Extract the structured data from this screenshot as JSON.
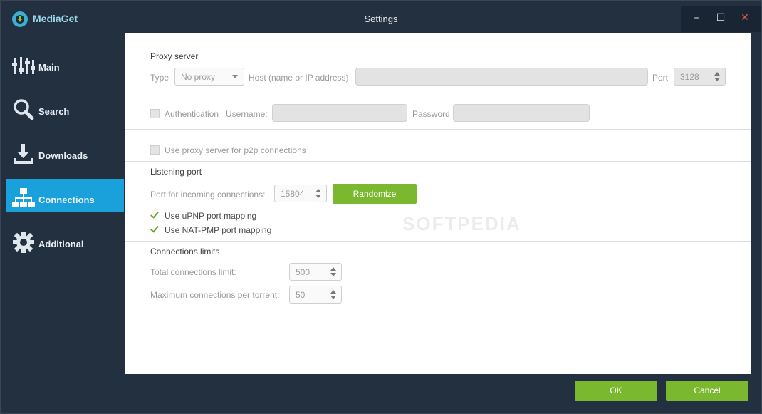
{
  "app": {
    "brand": "MediaGet",
    "window_title": "Settings"
  },
  "window_controls": {
    "minimize": "–",
    "maximize": "☐",
    "close": "✕"
  },
  "sidebar": {
    "items": [
      {
        "label": "Main",
        "icon": "equalizer-icon",
        "active": false
      },
      {
        "label": "Search",
        "icon": "search-icon",
        "active": false
      },
      {
        "label": "Downloads",
        "icon": "download-icon",
        "active": false
      },
      {
        "label": "Connections",
        "icon": "network-icon",
        "active": true
      },
      {
        "label": "Additional",
        "icon": "gear-icon",
        "active": false
      }
    ]
  },
  "proxy": {
    "section_title": "Proxy server",
    "type_label": "Type",
    "type_value": "No proxy",
    "host_label": "Host (name or IP address)",
    "host_value": "",
    "port_label": "Port",
    "port_value": "3128",
    "auth_label": "Authentication",
    "auth_checked": false,
    "username_label": "Username:",
    "username_value": "",
    "password_label": "Password",
    "password_value": "",
    "p2p_label": "Use proxy server for p2p connections",
    "p2p_checked": false
  },
  "listening": {
    "section_title": "Listening port",
    "port_label": "Port for incoming connections:",
    "port_value": "15804",
    "randomize_label": "Randomize",
    "upnp_label": "Use uPNP port mapping",
    "upnp_checked": true,
    "natpmp_label": "Use NAT-PMP port mapping",
    "natpmp_checked": true
  },
  "limits": {
    "section_title": "Connections limits",
    "total_label": "Total connections limit:",
    "total_value": "500",
    "per_torrent_label": "Maximum connections per torrent:",
    "per_torrent_value": "50"
  },
  "footer": {
    "ok_label": "OK",
    "cancel_label": "Cancel"
  },
  "watermark": "SOFTPEDIA",
  "colors": {
    "accent_blue": "#1aa1dc",
    "accent_green": "#7ab82f",
    "frame_dark": "#223040"
  }
}
